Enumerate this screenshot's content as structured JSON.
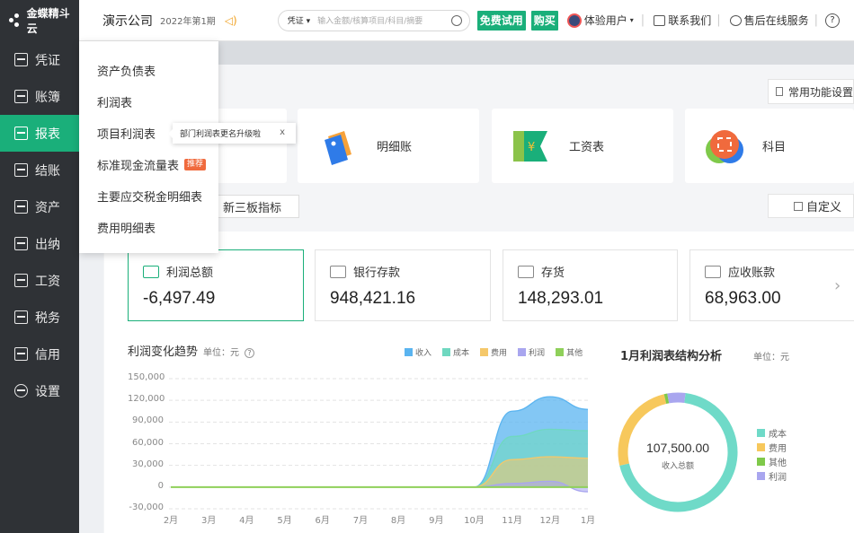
{
  "brand": {
    "name": "金蝶精斗云"
  },
  "sidebar": {
    "items": [
      {
        "label": "凭证",
        "icon": "voucher-icon"
      },
      {
        "label": "账簿",
        "icon": "ledger-icon"
      },
      {
        "label": "报表",
        "icon": "report-icon",
        "active": true
      },
      {
        "label": "结账",
        "icon": "checkout-icon"
      },
      {
        "label": "资产",
        "icon": "asset-icon"
      },
      {
        "label": "出纳",
        "icon": "cashier-icon"
      },
      {
        "label": "工资",
        "icon": "salary-icon"
      },
      {
        "label": "税务",
        "icon": "tax-icon"
      },
      {
        "label": "信用",
        "icon": "credit-icon"
      },
      {
        "label": "设置",
        "icon": "gear-icon"
      }
    ]
  },
  "header": {
    "company": "演示公司",
    "period": "2022年第1期",
    "search": {
      "type": "凭证",
      "placeholder": "输入金额/核算项目/科目/摘要"
    },
    "free_trial": "免费试用",
    "buy": "购买",
    "user": "体验用户",
    "contact": "联系我们",
    "support": "售后在线服务",
    "help": "?"
  },
  "dropdown": {
    "items": [
      {
        "label": "资产负债表"
      },
      {
        "label": "利润表"
      },
      {
        "label": "项目利润表"
      },
      {
        "label": "标准现金流量表",
        "tag": "推荐"
      },
      {
        "label": "主要应交税金明细表"
      },
      {
        "label": "费用明细表"
      }
    ]
  },
  "tooltip": {
    "text": "部门利润表更名升级啦",
    "close": "x"
  },
  "shortcuts": {
    "settings": "常用功能设置",
    "cards": [
      {
        "label": "明细账",
        "icon": "tags-icon"
      },
      {
        "label": "工资表",
        "icon": "salary-sheet-icon"
      },
      {
        "label": "科目",
        "icon": "subject-icon"
      }
    ],
    "sanban": "新三板指标",
    "customize": "自定义"
  },
  "kpis": [
    {
      "label": "利润总额",
      "value": "-6,497.49"
    },
    {
      "label": "银行存款",
      "value": "948,421.16"
    },
    {
      "label": "存货",
      "value": "148,293.01"
    },
    {
      "label": "应收账款",
      "value": "68,963.00"
    }
  ],
  "trend": {
    "title": "利润变化趋势",
    "unit": "单位：元",
    "colors": {
      "收入": "#5ab4f0",
      "成本": "#6fd8c0",
      "费用": "#f5c86a",
      "利润": "#a9a6ef",
      "其他": "#8fd05a"
    }
  },
  "donut": {
    "title": "1月利润表结构分析",
    "unit": "单位：元",
    "center_value": "107,500.00",
    "center_label": "收入总额",
    "colors": {
      "成本": "#6fdac8",
      "费用": "#f7c85c",
      "其他": "#7fc94a",
      "利润": "#a9a6ef"
    }
  },
  "chart_data": [
    {
      "type": "area",
      "title": "利润变化趋势",
      "ylabel": "单位：元",
      "categories": [
        "2月",
        "3月",
        "4月",
        "5月",
        "6月",
        "7月",
        "8月",
        "9月",
        "10月",
        "11月",
        "12月",
        "1月"
      ],
      "yticks": [
        150000,
        120000,
        90000,
        60000,
        30000,
        0,
        -30000
      ],
      "ytick_labels": [
        "150,000",
        "120,000",
        "90,000",
        "60,000",
        "30,000",
        "0",
        "-30,000"
      ],
      "ylim": [
        -30000,
        150000
      ],
      "grid": true,
      "legend": "top-right",
      "series": [
        {
          "name": "收入",
          "values": [
            0,
            0,
            0,
            0,
            0,
            0,
            0,
            0,
            0,
            105000,
            125000,
            107500
          ]
        },
        {
          "name": "成本",
          "values": [
            0,
            0,
            0,
            0,
            0,
            0,
            0,
            0,
            0,
            70000,
            80000,
            78000
          ]
        },
        {
          "name": "费用",
          "values": [
            0,
            0,
            0,
            0,
            0,
            0,
            0,
            0,
            0,
            38000,
            42000,
            40000
          ]
        },
        {
          "name": "利润",
          "values": [
            0,
            0,
            0,
            0,
            0,
            0,
            0,
            0,
            0,
            5000,
            8000,
            -6497.49
          ]
        },
        {
          "name": "其他",
          "values": [
            0,
            0,
            0,
            0,
            0,
            0,
            0,
            0,
            0,
            0,
            0,
            0
          ]
        }
      ]
    },
    {
      "type": "pie",
      "title": "1月利润表结构分析",
      "categories": [
        "成本",
        "费用",
        "其他",
        "利润"
      ],
      "values": [
        78000,
        28000,
        1000,
        5500
      ],
      "legend": "right"
    }
  ]
}
